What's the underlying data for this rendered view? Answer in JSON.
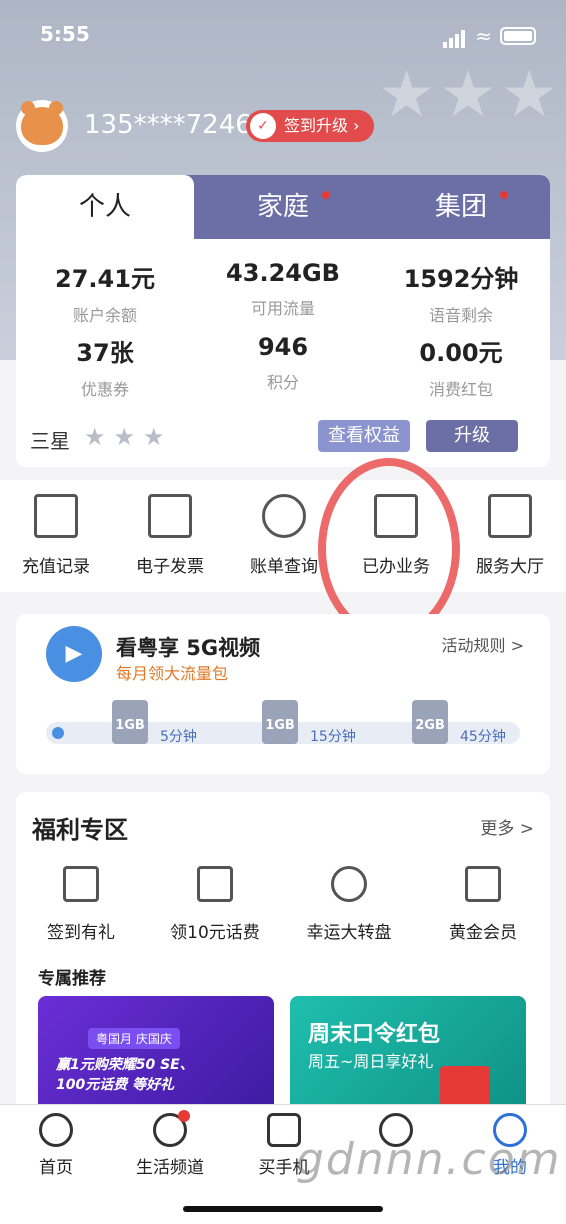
{
  "status": {
    "time": "5:55"
  },
  "header": {
    "phone": "135****7246",
    "signup_label": "签到升级"
  },
  "tabs": [
    {
      "label": "个人",
      "active": true,
      "dot": false
    },
    {
      "label": "家庭",
      "active": false,
      "dot": true
    },
    {
      "label": "集团",
      "active": false,
      "dot": true
    }
  ],
  "stats": [
    {
      "value": "27.41元",
      "label": "账户余额"
    },
    {
      "value": "43.24GB",
      "label": "可用流量"
    },
    {
      "value": "1592分钟",
      "label": "语音剩余"
    },
    {
      "value": "37张",
      "label": "优惠券"
    },
    {
      "value": "946",
      "label": "积分"
    },
    {
      "value": "0.00元",
      "label": "消费红包"
    }
  ],
  "level": {
    "label": "三星",
    "stars": 3,
    "view_benefits": "查看权益",
    "upgrade": "升级"
  },
  "shortcuts": [
    {
      "label": "充值记录",
      "icon": "recharge-record-icon"
    },
    {
      "label": "电子发票",
      "icon": "invoice-icon"
    },
    {
      "label": "账单查询",
      "icon": "bill-query-icon"
    },
    {
      "label": "已办业务",
      "icon": "handled-business-icon"
    },
    {
      "label": "服务大厅",
      "icon": "service-hall-icon"
    }
  ],
  "promo": {
    "title": "看粤享 5G视频",
    "subtitle": "每月领大流量包",
    "rules": "活动规则 >",
    "gifts": [
      {
        "size": "1GB",
        "time": "5分钟"
      },
      {
        "size": "1GB",
        "time": "15分钟"
      },
      {
        "size": "2GB",
        "time": "45分钟"
      }
    ]
  },
  "welfare": {
    "title": "福利专区",
    "more": "更多 >",
    "items": [
      {
        "label": "签到有礼",
        "icon": "calendar-check-icon"
      },
      {
        "label": "领10元话费",
        "icon": "discount-card-icon"
      },
      {
        "label": "幸运大转盘",
        "icon": "wheel-icon"
      },
      {
        "label": "黄金会员",
        "icon": "crown-icon"
      }
    ],
    "exclusive": "专属推荐",
    "banner1": {
      "tag": "粤国月 庆国庆",
      "line1": "赢1元购荣耀50 SE、",
      "line2": "100元话费 等好礼"
    },
    "banner2": {
      "title": "周末口令红包",
      "subtitle": "周五~周日享好礼"
    }
  },
  "nav": [
    {
      "label": "首页",
      "icon": "home-icon"
    },
    {
      "label": "生活频道",
      "icon": "coffee-icon",
      "badge": true
    },
    {
      "label": "买手机",
      "icon": "phone-icon"
    },
    {
      "label": "",
      "icon": "bunny-icon"
    },
    {
      "label": "我的",
      "icon": "user-icon"
    }
  ],
  "watermark": "gdnnn.com"
}
